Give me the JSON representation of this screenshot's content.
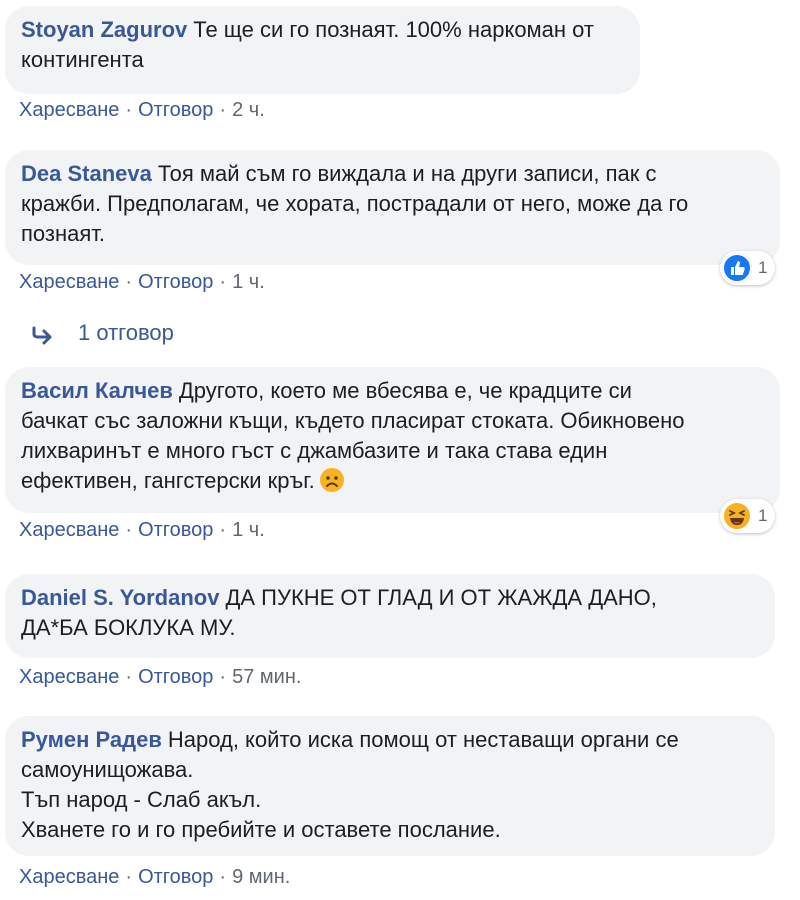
{
  "actions": {
    "like_label": "Харесване",
    "reply_label": "Отговор",
    "separator": "·"
  },
  "comments": [
    {
      "author": "Stoyan Zagurov",
      "lines": [
        "Те ще си го познаят. 100% наркоман от",
        "контингента"
      ],
      "time": "2 ч."
    },
    {
      "author": "Dea Staneva",
      "lines": [
        "Тоя май съм го виждала и на други записи, пак с",
        "кражби. Предполагам, че хората, пострадали от него, може да го",
        "познаят."
      ],
      "time": "1 ч.",
      "reaction": {
        "icon": "like-icon",
        "count": "1"
      }
    },
    {
      "author": "Васил Калчев",
      "lines": [
        "Другото, което ме вбесява е, че крадците си",
        "бачкат със заложни къщи, където пласират стоката. Обикновено",
        "лихваринът е много гъст с джамбазите и така става един",
        "ефективен, гангстерски кръг."
      ],
      "emoji": "sad-face-icon",
      "time": "1 ч.",
      "reaction": {
        "icon": "haha-icon",
        "count": "1"
      }
    },
    {
      "author": "Daniel S. Yordanov",
      "lines": [
        "ДА ПУКНЕ ОТ ГЛАД И ОТ ЖАЖДА ДАНО,",
        "ДА*БА БОКЛУКА МУ."
      ],
      "time": "57 мин."
    },
    {
      "author": "Румен Радев",
      "lines": [
        "Народ, който иска помощ от неставащи органи се",
        "самоунищожава.",
        "Тъп народ - Слаб акъл.",
        "Хванете го и го пребийте и оставете послание."
      ],
      "time": "9 мин."
    }
  ],
  "replies": {
    "label": "1 отговор"
  },
  "colors": {
    "author": "#385898",
    "bubble": "#f2f3f5",
    "meta": "#606770",
    "like": "#1877f2",
    "haha": "#f7b125"
  }
}
